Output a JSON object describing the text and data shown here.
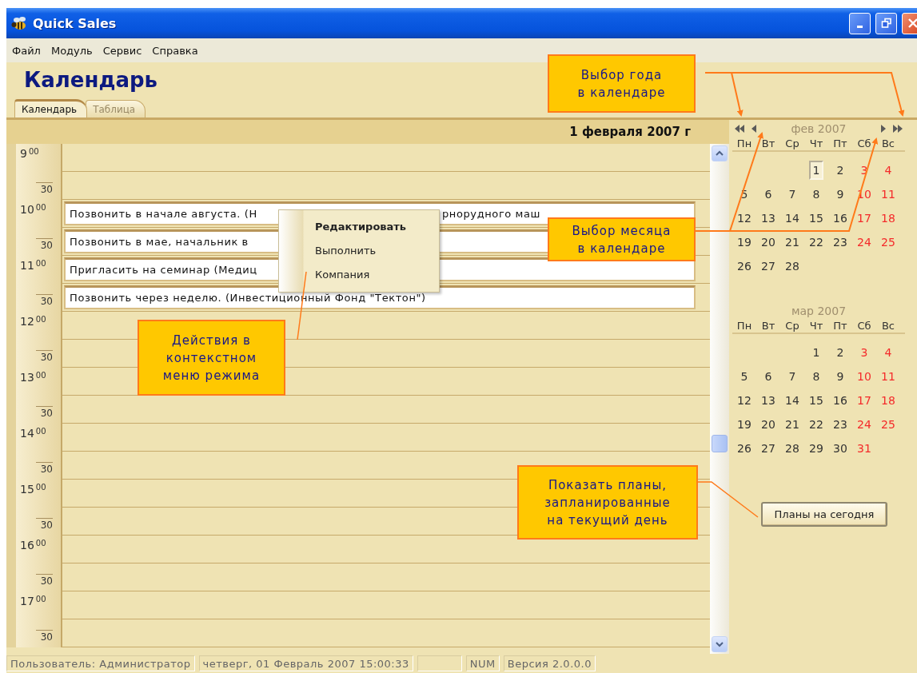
{
  "window": {
    "title": "Quick Sales"
  },
  "menu": [
    {
      "label": "Файл"
    },
    {
      "label": "Модуль"
    },
    {
      "label": "Сервис"
    },
    {
      "label": "Справка"
    }
  ],
  "page_title": "Календарь",
  "tabs": [
    {
      "label": "Календарь",
      "selected": true
    },
    {
      "label": "Таблица",
      "selected": false
    }
  ],
  "day_header": "1 февраля 2007 г",
  "slots": [
    {
      "kind": "hour",
      "hour": "9",
      "minutes": "00"
    },
    {
      "kind": "half",
      "minutes": "30"
    },
    {
      "kind": "hour",
      "hour": "10",
      "minutes": "00",
      "event": {
        "segments": [
          "Позвонить в начале августа. (Н",
          "рнорудного маш"
        ]
      }
    },
    {
      "kind": "half",
      "minutes": "30",
      "event": {
        "segments": [
          "Позвонить в мае, начальник в"
        ]
      }
    },
    {
      "kind": "hour",
      "hour": "11",
      "minutes": "00",
      "event": {
        "segments": [
          "Пригласить на семинар (Медиц"
        ]
      }
    },
    {
      "kind": "half",
      "minutes": "30",
      "event": {
        "segments": [
          "Позвонить через неделю. (Инвестиционный Фонд \"Тектон\")"
        ]
      }
    },
    {
      "kind": "hour",
      "hour": "12",
      "minutes": "00"
    },
    {
      "kind": "half",
      "minutes": "30"
    },
    {
      "kind": "hour",
      "hour": "13",
      "minutes": "00"
    },
    {
      "kind": "half",
      "minutes": "30"
    },
    {
      "kind": "hour",
      "hour": "14",
      "minutes": "00"
    },
    {
      "kind": "half",
      "minutes": "30"
    },
    {
      "kind": "hour",
      "hour": "15",
      "minutes": "00"
    },
    {
      "kind": "half",
      "minutes": "30"
    },
    {
      "kind": "hour",
      "hour": "16",
      "minutes": "00"
    },
    {
      "kind": "half",
      "minutes": "30"
    },
    {
      "kind": "hour",
      "hour": "17",
      "minutes": "00"
    },
    {
      "kind": "half",
      "minutes": "30"
    }
  ],
  "context_menu": [
    {
      "label": "Редактировать",
      "default": true
    },
    {
      "label": "Выполнить",
      "default": false
    },
    {
      "label": "Компания",
      "default": false
    }
  ],
  "calendars": [
    {
      "title": "фев 2007",
      "kind": "navigable",
      "weekdays": [
        {
          "label": "Пн",
          "weekend": false
        },
        {
          "label": "Вт",
          "weekend": false
        },
        {
          "label": "Ср",
          "weekend": false
        },
        {
          "label": "Чт",
          "weekend": false
        },
        {
          "label": "Пт",
          "weekend": false
        },
        {
          "label": "Сб",
          "weekend": true
        },
        {
          "label": "Вс",
          "weekend": true
        }
      ],
      "weeks": [
        {
          "align_right": true,
          "days": [
            {
              "day": "1",
              "selected": true
            },
            {
              "day": "2",
              "selected": false
            },
            {
              "day": "3",
              "selected": false
            },
            {
              "day": "4",
              "selected": false
            }
          ]
        },
        {
          "days": [
            {
              "day": "5",
              "selected": false
            },
            {
              "day": "6",
              "selected": false
            },
            {
              "day": "7",
              "selected": false
            },
            {
              "day": "8",
              "selected": false
            },
            {
              "day": "9",
              "selected": false
            },
            {
              "day": "10",
              "selected": false
            },
            {
              "day": "11",
              "selected": false
            }
          ]
        },
        {
          "days": [
            {
              "day": "12",
              "selected": false
            },
            {
              "day": "13",
              "selected": false
            },
            {
              "day": "14",
              "selected": false
            },
            {
              "day": "15",
              "selected": false
            },
            {
              "day": "16",
              "selected": false
            },
            {
              "day": "17",
              "selected": false
            },
            {
              "day": "18",
              "selected": false
            }
          ]
        },
        {
          "days": [
            {
              "day": "19",
              "selected": false
            },
            {
              "day": "20",
              "selected": false
            },
            {
              "day": "21",
              "selected": false
            },
            {
              "day": "22",
              "selected": false
            },
            {
              "day": "23",
              "selected": false
            },
            {
              "day": "24",
              "selected": false
            },
            {
              "day": "25",
              "selected": false
            }
          ]
        },
        {
          "align_right": false,
          "days": [
            {
              "day": "26",
              "selected": false
            },
            {
              "day": "27",
              "selected": false
            },
            {
              "day": "28",
              "selected": false
            }
          ]
        }
      ]
    },
    {
      "title": "мар 2007",
      "kind": "plain",
      "weekdays": [
        {
          "label": "Пн",
          "weekend": false
        },
        {
          "label": "Вт",
          "weekend": false
        },
        {
          "label": "Ср",
          "weekend": false
        },
        {
          "label": "Чт",
          "weekend": false
        },
        {
          "label": "Пт",
          "weekend": false
        },
        {
          "label": "Сб",
          "weekend": true
        },
        {
          "label": "Вс",
          "weekend": true
        }
      ],
      "weeks": [
        {
          "align_right": true,
          "days": [
            {
              "day": "1",
              "selected": false
            },
            {
              "day": "2",
              "selected": false
            },
            {
              "day": "3",
              "selected": false
            },
            {
              "day": "4",
              "selected": false
            }
          ]
        },
        {
          "days": [
            {
              "day": "5",
              "selected": false
            },
            {
              "day": "6",
              "selected": false
            },
            {
              "day": "7",
              "selected": false
            },
            {
              "day": "8",
              "selected": false
            },
            {
              "day": "9",
              "selected": false
            },
            {
              "day": "10",
              "selected": false
            },
            {
              "day": "11",
              "selected": false
            }
          ]
        },
        {
          "days": [
            {
              "day": "12",
              "selected": false
            },
            {
              "day": "13",
              "selected": false
            },
            {
              "day": "14",
              "selected": false
            },
            {
              "day": "15",
              "selected": false
            },
            {
              "day": "16",
              "selected": false
            },
            {
              "day": "17",
              "selected": false
            },
            {
              "day": "18",
              "selected": false
            }
          ]
        },
        {
          "days": [
            {
              "day": "19",
              "selected": false
            },
            {
              "day": "20",
              "selected": false
            },
            {
              "day": "21",
              "selected": false
            },
            {
              "day": "22",
              "selected": false
            },
            {
              "day": "23",
              "selected": false
            },
            {
              "day": "24",
              "selected": false
            },
            {
              "day": "25",
              "selected": false
            }
          ]
        },
        {
          "align_right": false,
          "days": [
            {
              "day": "26",
              "selected": false
            },
            {
              "day": "27",
              "selected": false
            },
            {
              "day": "28",
              "selected": false
            },
            {
              "day": "29",
              "selected": false
            },
            {
              "day": "30",
              "selected": false
            },
            {
              "day": "31",
              "selected": false
            }
          ]
        }
      ]
    }
  ],
  "today_button": "Планы на сегодня",
  "callouts": [
    {
      "lines": [
        "Выбор года",
        "в календаре"
      ]
    },
    {
      "lines": [
        "Выбор месяца",
        "в календаре"
      ]
    },
    {
      "lines": [
        "Действия в",
        "контекстном",
        "меню режима"
      ]
    },
    {
      "lines": [
        "Показать планы,",
        "запланированные",
        "на текущий день"
      ]
    }
  ],
  "status_bar": [
    {
      "kind": "text",
      "text": "Пользователь: Администратор"
    },
    {
      "kind": "text",
      "text": "четверг, 01 Февраль 2007 15:00:33"
    },
    {
      "kind": "blank"
    },
    {
      "kind": "text",
      "text": "NUM"
    },
    {
      "kind": "text",
      "text": "Версия 2.0.0.0"
    }
  ]
}
